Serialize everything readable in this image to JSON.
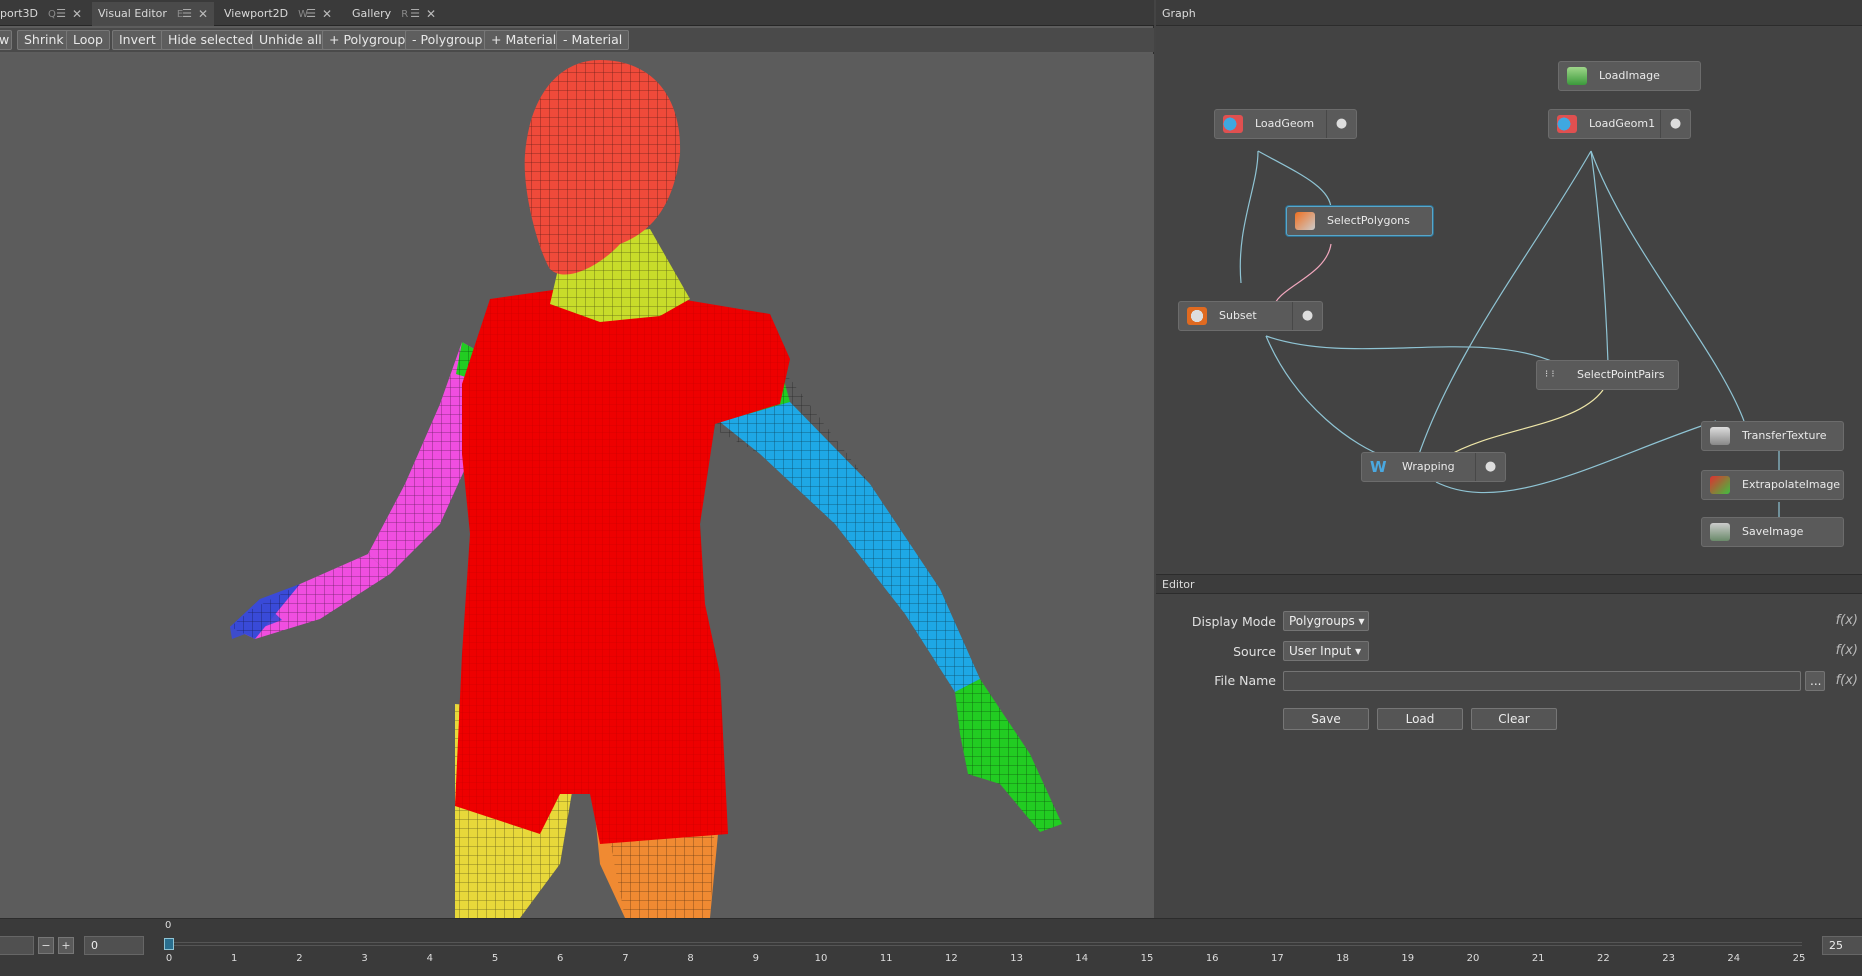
{
  "tabs": [
    {
      "label": "port3D",
      "key": "Q"
    },
    {
      "label": "Visual Editor",
      "key": "E"
    },
    {
      "label": "Viewport2D",
      "key": "W"
    },
    {
      "label": "Gallery",
      "key": "R"
    }
  ],
  "toolbar": [
    "w",
    "Shrink",
    "Loop",
    "Invert",
    "Hide selected",
    "Unhide all",
    "+ Polygroup",
    "- Polygroup",
    "+ Material",
    "- Material"
  ],
  "graph": {
    "title": "Graph",
    "nodes": [
      "LoadImage",
      "LoadGeom",
      "LoadGeom1",
      "SelectPolygons",
      "Subset",
      "SelectPointPairs",
      "TransferTexture",
      "Wrapping",
      "ExtrapolateImage",
      "SaveImage"
    ],
    "selected": "SelectPolygons"
  },
  "editor": {
    "title": "Editor",
    "display_mode_label": "Display Mode",
    "display_mode_value": "Polygroups",
    "source_label": "Source",
    "source_value": "User Input",
    "file_name_label": "File Name",
    "file_name_value": "",
    "browse": "...",
    "fx": "f(x)",
    "save": "Save",
    "load": "Load",
    "clear": "Clear"
  },
  "timeline": {
    "current": "0",
    "marker": "0",
    "end": "25",
    "minus": "−",
    "plus": "+",
    "ticks": [
      "0",
      "1",
      "2",
      "3",
      "4",
      "5",
      "6",
      "7",
      "8",
      "9",
      "10",
      "11",
      "12",
      "13",
      "14",
      "15",
      "16",
      "17",
      "18",
      "19",
      "20",
      "21",
      "22",
      "23",
      "24",
      "25"
    ]
  },
  "colors": {
    "background": "#5c5c5c",
    "accent": "#5aa6c8",
    "wire": "#8fc4d4",
    "wire_pink": "#f1a7bd",
    "wire_yellow": "#eee6a8"
  }
}
